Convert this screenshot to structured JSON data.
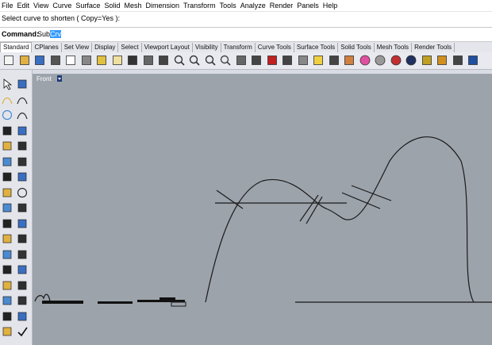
{
  "menu": [
    "File",
    "Edit",
    "View",
    "Curve",
    "Surface",
    "Solid",
    "Mesh",
    "Dimension",
    "Transform",
    "Tools",
    "Analyze",
    "Render",
    "Panels",
    "Help"
  ],
  "prompt": "Select curve to shorten ( Copy=Yes ):",
  "command": {
    "label": "Command:",
    "typed": "Sub",
    "selected": "Crv"
  },
  "tabs": [
    "Standard",
    "CPlanes",
    "Set View",
    "Display",
    "Select",
    "Viewport Layout",
    "Visibility",
    "Transform",
    "Curve Tools",
    "Surface Tools",
    "Solid Tools",
    "Mesh Tools",
    "Render Tools"
  ],
  "toolbar_icons": [
    "new-icon",
    "open-icon",
    "save-icon",
    "print-icon",
    "import-icon",
    "cut-icon",
    "copy-icon",
    "paste-icon",
    "undo-icon",
    "pan-icon",
    "move-icon",
    "zoom-dynamic-icon",
    "zoom-window-icon",
    "zoom-extents-icon",
    "zoom-selected-icon",
    "rotate-view-icon",
    "four-view-icon",
    "car-icon",
    "options-icon",
    "cplane-icon",
    "light-icon",
    "lock-icon",
    "layer-icon",
    "color-wheel-icon",
    "sphere-shade-icon",
    "material-sphere-icon",
    "render-sphere-icon",
    "pen-icon",
    "gear-icon",
    "grid-icon",
    "help-icon"
  ],
  "side_icons": [
    "select-arrow-icon",
    "point-icon",
    "polyline-icon",
    "curve-icon",
    "circle-icon",
    "arc-icon",
    "ellipse-icon",
    "rectangle-icon",
    "polygon-icon",
    "freeform-icon",
    "fillet-icon",
    "offset-icon",
    "surface-icon",
    "extrude-icon",
    "box-icon",
    "sphere-icon",
    "cylinder-icon",
    "solid-tools-icon",
    "boolean-icon",
    "mesh-icon",
    "transform-icon",
    "array-icon",
    "scale-icon",
    "trim-icon",
    "split-icon",
    "join-icon",
    "group-icon",
    "explode-icon",
    "rotate-icon",
    "mirror-icon",
    "dimension-icon",
    "text-icon",
    "hatch-icon",
    "check-icon"
  ],
  "viewport": {
    "title": "Front"
  },
  "colors": {
    "viewport_bg": "#9da3ab",
    "selection": "#3399ff",
    "curve": "#1a1a1a"
  }
}
